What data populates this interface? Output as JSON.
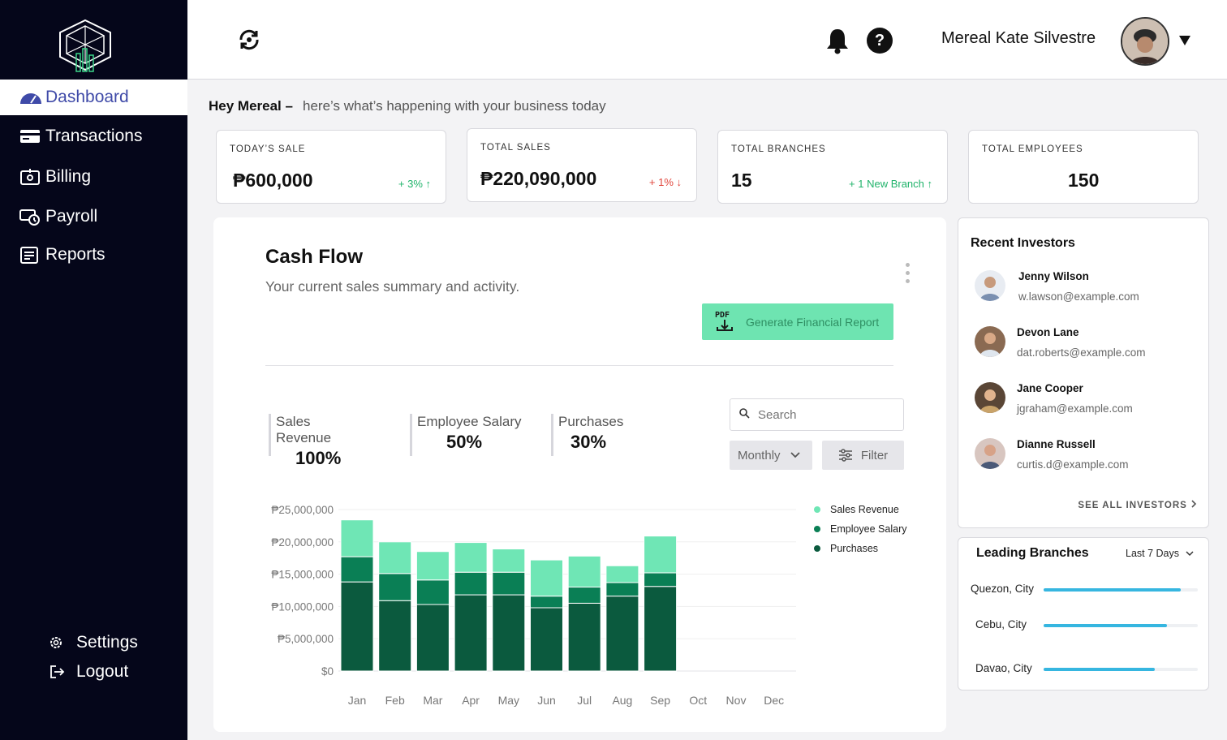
{
  "sidebar": {
    "items": [
      {
        "label": "Dashboard",
        "icon": "gauge-icon"
      },
      {
        "label": "Transactions",
        "icon": "credit-card-icon"
      },
      {
        "label": "Billing",
        "icon": "billing-icon"
      },
      {
        "label": "Payroll",
        "icon": "payroll-icon"
      },
      {
        "label": "Reports",
        "icon": "report-icon"
      }
    ],
    "settings_label": "Settings",
    "logout_label": "Logout"
  },
  "header": {
    "user_name": "Mereal Kate Silvestre",
    "help_glyph": "?"
  },
  "greeting": {
    "name": "Hey Mereal –",
    "text": "here’s what’s happening with your business today"
  },
  "kpis": [
    {
      "label": "TODAY’S SALE",
      "value": "₱600,000",
      "change": "+ 3% ↑",
      "trend": "up"
    },
    {
      "label": "TOTAL SALES",
      "value": "₱220,090,000",
      "change": "+ 1% ↓",
      "trend": "down"
    },
    {
      "label": "TOTAL BRANCHES",
      "value": "15",
      "change": "+ 1 New Branch ↑",
      "trend": "up"
    },
    {
      "label": "TOTAL EMPLOYEES",
      "value": "150",
      "change": "",
      "trend": ""
    }
  ],
  "cashflow": {
    "title": "Cash Flow",
    "subtitle": "Your current sales summary and activity.",
    "generate_label": "Generate Financial Report",
    "pdf_label": "PDF",
    "stats": [
      {
        "label": "Sales Revenue",
        "value": "100%"
      },
      {
        "label": "Employee Salary",
        "value": "50%"
      },
      {
        "label": "Purchases",
        "value": "30%"
      }
    ],
    "search_placeholder": "Search",
    "period_label": "Monthly",
    "filter_label": "Filter"
  },
  "chart_data": {
    "type": "bar",
    "stacked": true,
    "categories": [
      "Jan",
      "Feb",
      "Mar",
      "Apr",
      "May",
      "Jun",
      "Jul",
      "Aug",
      "Sep",
      "Oct",
      "Nov",
      "Dec"
    ],
    "series": [
      {
        "name": "Purchases",
        "color": "#0b5a3e",
        "values": [
          13800000,
          10900000,
          10300000,
          11800000,
          11800000,
          9800000,
          10500000,
          11600000,
          13100000,
          0,
          0,
          0
        ]
      },
      {
        "name": "Employee Salary",
        "color": "#0a7f55",
        "values": [
          3900000,
          4200000,
          3800000,
          3500000,
          3500000,
          1800000,
          2500000,
          2100000,
          2100000,
          0,
          0,
          0
        ]
      },
      {
        "name": "Sales Revenue",
        "color": "#6fe6b5",
        "values": [
          5700000,
          4900000,
          4400000,
          4600000,
          3600000,
          5600000,
          4800000,
          2600000,
          5700000,
          0,
          0,
          0
        ]
      }
    ],
    "legend_order": [
      "Sales Revenue",
      "Employee Salary",
      "Purchases"
    ],
    "ylim": [
      0,
      25000000
    ],
    "yticks": [
      "₱25,000,000",
      "₱20,000,000",
      "₱15,000,000",
      "₱10,000,000",
      "₱5,000,000",
      "$0"
    ],
    "grid": true,
    "legend_position": "right"
  },
  "investors": {
    "title": "Recent Investors",
    "see_all": "SEE ALL INVESTORS",
    "list": [
      {
        "name": "Jenny Wilson",
        "email": "w.lawson@example.com",
        "avatar_color": "#7a8fb0"
      },
      {
        "name": "Devon Lane",
        "email": "dat.roberts@example.com",
        "avatar_color": "#8a6a52"
      },
      {
        "name": "Jane Cooper",
        "email": "jgraham@example.com",
        "avatar_color": "#5a4636"
      },
      {
        "name": "Dianne Russell",
        "email": "curtis.d@example.com",
        "avatar_color": "#9a5a5a"
      }
    ]
  },
  "branches": {
    "title": "Leading Branches",
    "range_label": "Last 7 Days",
    "list": [
      {
        "name": "Quezon, City",
        "level": 0.89
      },
      {
        "name": "Cebu, City",
        "level": 0.8
      },
      {
        "name": "Davao, City",
        "level": 0.72
      }
    ]
  }
}
